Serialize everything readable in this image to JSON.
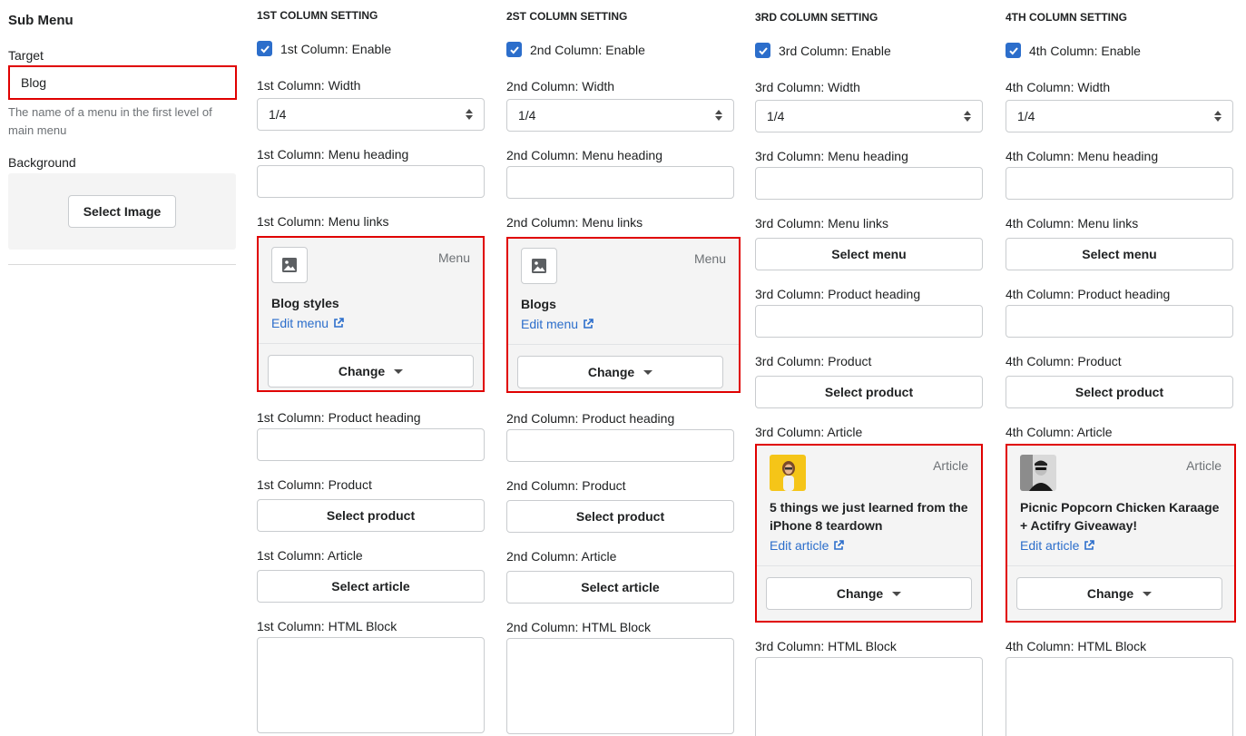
{
  "sidebar": {
    "title": "Sub Menu",
    "target_label": "Target",
    "target_value": "Blog",
    "help_text": "The name of a menu in the first level of main menu",
    "background_label": "Background",
    "select_image_label": "Select Image"
  },
  "columns": [
    {
      "heading": "1ST COLUMN SETTING",
      "enable_label": "1st Column: Enable",
      "enabled": true,
      "width_label": "1st Column: Width",
      "width_value": "1/4",
      "menu_heading_label": "1st Column: Menu heading",
      "menu_links_label": "1st Column: Menu links",
      "menu_card": {
        "type": "Menu",
        "title": "Blog styles",
        "link": "Edit menu",
        "change": "Change"
      },
      "product_heading_label": "1st Column: Product heading",
      "product_label": "1st Column: Product",
      "select_product": "Select product",
      "article_label": "1st Column: Article",
      "select_article": "Select article",
      "html_block_label": "1st Column: HTML Block"
    },
    {
      "heading": "2ST COLUMN SETTING",
      "enable_label": "2nd Column: Enable",
      "enabled": true,
      "width_label": "2nd Column: Width",
      "width_value": "1/4",
      "menu_heading_label": "2nd Column: Menu heading",
      "menu_links_label": "2nd Column: Menu links",
      "menu_card": {
        "type": "Menu",
        "title": "Blogs",
        "link": "Edit menu",
        "change": "Change"
      },
      "product_heading_label": "2nd Column: Product heading",
      "product_label": "2nd Column: Product",
      "select_product": "Select product",
      "article_label": "2nd Column: Article",
      "select_article": "Select article",
      "html_block_label": "2nd Column: HTML Block"
    },
    {
      "heading": "3RD COLUMN SETTING",
      "enable_label": "3rd Column: Enable",
      "enabled": true,
      "width_label": "3rd Column: Width",
      "width_value": "1/4",
      "menu_heading_label": "3rd Column: Menu heading",
      "menu_links_label": "3rd Column: Menu links",
      "select_menu": "Select menu",
      "product_heading_label": "3rd Column: Product heading",
      "product_label": "3rd Column: Product",
      "select_product": "Select product",
      "article_label": "3rd Column: Article",
      "article_card": {
        "type": "Article",
        "title": "5 things we just learned from the iPhone 8 teardown",
        "link": "Edit article",
        "change": "Change"
      },
      "html_block_label": "3rd Column: HTML Block"
    },
    {
      "heading": "4TH COLUMN SETTING",
      "enable_label": "4th Column: Enable",
      "enabled": true,
      "width_label": "4th Column: Width",
      "width_value": "1/4",
      "menu_heading_label": "4th Column: Menu heading",
      "menu_links_label": "4th Column: Menu links",
      "select_menu": "Select menu",
      "product_heading_label": "4th Column: Product heading",
      "product_label": "4th Column: Product",
      "select_product": "Select product",
      "article_label": "4th Column: Article",
      "article_card": {
        "type": "Article",
        "title": "Picnic Popcorn Chicken Karaage + Actifry Giveaway!",
        "link": "Edit article",
        "change": "Change"
      },
      "html_block_label": "4th Column: HTML Block"
    }
  ],
  "colors": {
    "accent": "#2c6ecb",
    "highlight_border": "#e00000",
    "card_bg": "#f4f4f4"
  }
}
